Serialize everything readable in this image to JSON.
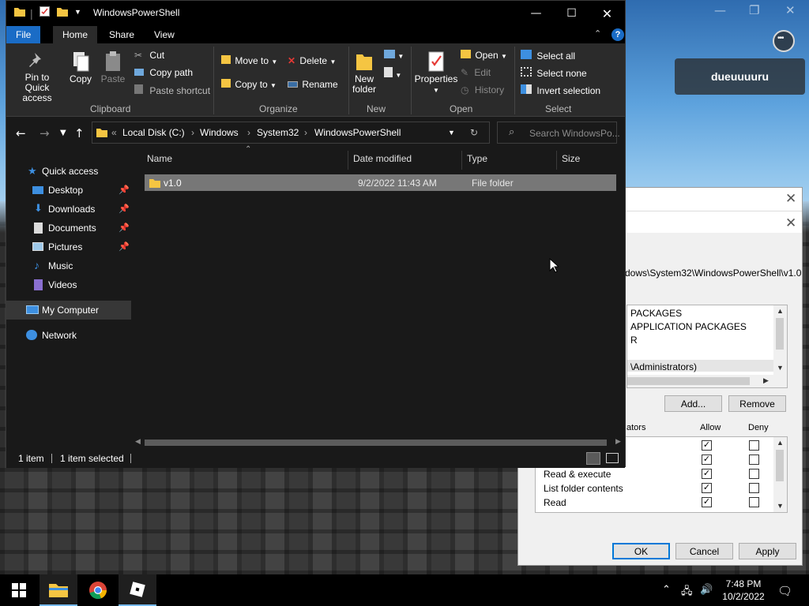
{
  "colors": {
    "explorer_bg": "#191919",
    "ribbon_bg": "#2b2b2b",
    "file_tab": "#1a6cc6",
    "folder": "#f5c542",
    "accent": "#0078d7"
  },
  "game": {
    "player_name": "dueuuuuru",
    "chat_icon": "chat-bubble-icon"
  },
  "explorer": {
    "title": "WindowsPowerShell",
    "tabs": {
      "file": "File",
      "home": "Home",
      "share": "Share",
      "view": "View"
    },
    "ribbon": {
      "clipboard": {
        "pin": "Pin to Quick access",
        "copy": "Copy",
        "paste": "Paste",
        "cut": "Cut",
        "copy_path": "Copy path",
        "paste_shortcut": "Paste shortcut",
        "label": "Clipboard"
      },
      "organize": {
        "move_to": "Move to",
        "copy_to": "Copy to",
        "delete": "Delete",
        "rename": "Rename",
        "label": "Organize"
      },
      "new": {
        "new_folder": "New folder",
        "label": "New"
      },
      "open": {
        "properties": "Properties",
        "open": "Open",
        "edit": "Edit",
        "history": "History",
        "label": "Open"
      },
      "select": {
        "select_all": "Select all",
        "select_none": "Select none",
        "invert": "Invert selection",
        "label": "Select"
      }
    },
    "address": {
      "chevrons": "«",
      "crumbs": [
        "Local Disk (C:)",
        "Windows",
        "System32",
        "WindowsPowerShell"
      ]
    },
    "search": {
      "placeholder": "Search WindowsPo..."
    },
    "nav": {
      "quick_access": "Quick access",
      "items": [
        "Desktop",
        "Downloads",
        "Documents",
        "Pictures",
        "Music",
        "Videos"
      ],
      "my_computer": "My Computer",
      "network": "Network"
    },
    "columns": {
      "name": "Name",
      "date": "Date modified",
      "type": "Type",
      "size": "Size"
    },
    "files": [
      {
        "name": "v1.0",
        "date": "9/2/2022 11:43 AM",
        "type": "File folder",
        "size": ""
      }
    ],
    "status": {
      "count": "1 item",
      "selected": "1 item selected"
    }
  },
  "dialog": {
    "path": "dows\\System32\\WindowsPowerShell\\v1.0",
    "groups": [
      "PACKAGES",
      "APPLICATION PACKAGES",
      "R",
      "",
      "\\Administrators)"
    ],
    "add": "Add...",
    "remove": "Remove",
    "perm_header": "ators",
    "allow": "Allow",
    "deny": "Deny",
    "permissions": [
      {
        "name": "",
        "allow": true,
        "deny": false
      },
      {
        "name": "",
        "allow": true,
        "deny": false
      },
      {
        "name": "Read & execute",
        "allow": true,
        "deny": false
      },
      {
        "name": "List folder contents",
        "allow": true,
        "deny": false
      },
      {
        "name": "Read",
        "allow": true,
        "deny": false
      }
    ],
    "ok": "OK",
    "cancel": "Cancel",
    "apply": "Apply"
  },
  "taskbar": {
    "icons": [
      "windows-start-icon",
      "file-explorer-icon",
      "chrome-icon",
      "roblox-icon"
    ],
    "time": "7:48 PM",
    "date": "10/2/2022"
  }
}
